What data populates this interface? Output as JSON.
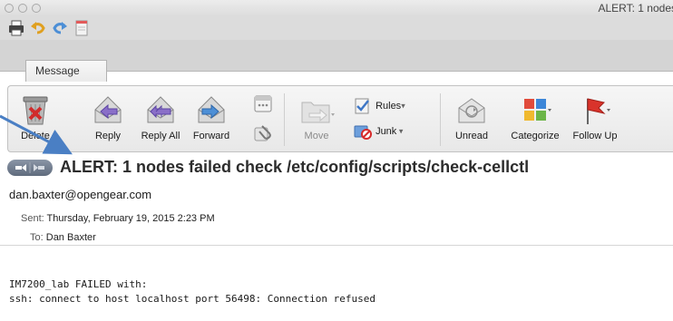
{
  "window": {
    "title": "ALERT: 1 nodes",
    "traffic_lights": [
      "close",
      "minimize",
      "zoom"
    ]
  },
  "quick_access": {
    "icons": [
      "printer-icon",
      "undo-icon",
      "redo-icon",
      "note-icon"
    ]
  },
  "tabs": [
    {
      "label": "Message",
      "selected": true
    }
  ],
  "ribbon": {
    "delete_label": "Delete",
    "reply_label": "Reply",
    "reply_all_label": "Reply All",
    "forward_label": "Forward",
    "move_label": "Move",
    "rules_label": "Rules",
    "junk_label": "Junk",
    "unread_label": "Unread",
    "categorize_label": "Categorize",
    "follow_up_label": "Follow Up"
  },
  "message": {
    "subject": "ALERT: 1 nodes failed check /etc/config/scripts/check-cellctl",
    "from": "dan.baxter@opengear.com",
    "sent_key": "Sent:",
    "sent_value": "Thursday, February 19, 2015 2:23 PM",
    "to_key": "To:",
    "to_value": "Dan Baxter",
    "body_line1": "IM7200_lab FAILED with:",
    "body_line2": "ssh: connect to host localhost port 56498: Connection refused"
  },
  "colors": {
    "accent_arrow": "#4a7fc4",
    "reply_arrow": "#8a6fc8",
    "follow_up_flag": "#d9332b"
  }
}
